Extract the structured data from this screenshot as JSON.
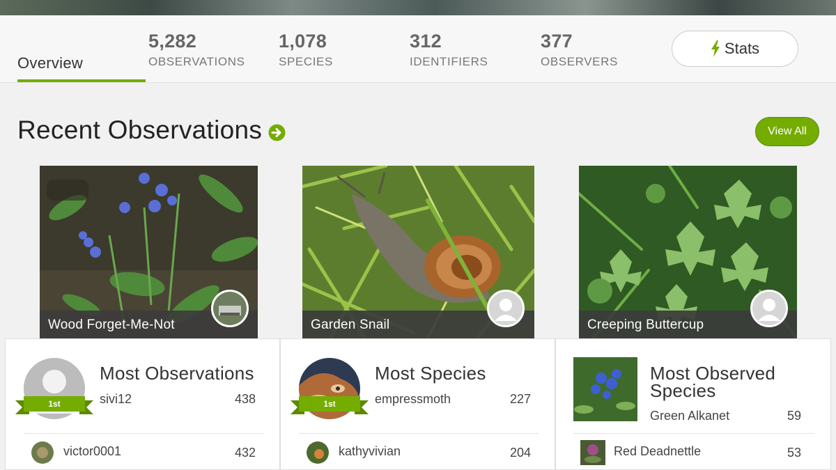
{
  "tabs": {
    "overview": "Overview"
  },
  "stats": [
    {
      "value": "5,282",
      "label": "OBSERVATIONS"
    },
    {
      "value": "1,078",
      "label": "SPECIES"
    },
    {
      "value": "312",
      "label": "IDENTIFIERS"
    },
    {
      "value": "377",
      "label": "OBSERVERS"
    }
  ],
  "stats_button": {
    "label": "Stats",
    "icon": "bolt-icon"
  },
  "recent": {
    "title": "Recent Observations",
    "view_all": "View All",
    "observations": [
      {
        "name": "Wood Forget-Me-Not",
        "avatar": "user-photo"
      },
      {
        "name": "Garden Snail",
        "avatar": "default-user-icon"
      },
      {
        "name": "Creeping Buttercup",
        "avatar": "default-user-icon"
      }
    ]
  },
  "leaders": {
    "most_observations": {
      "title": "Most Observations",
      "rank": "1st",
      "first": {
        "name": "sivi12",
        "count": "438"
      },
      "second": {
        "name": "victor0001",
        "count": "432"
      }
    },
    "most_species": {
      "title": "Most Species",
      "rank": "1st",
      "first": {
        "name": "empressmoth",
        "count": "227"
      },
      "second": {
        "name": "kathyvivian",
        "count": "204"
      }
    },
    "most_observed_species": {
      "title": "Most Observed Species",
      "first": {
        "name": "Green Alkanet",
        "count": "59"
      },
      "second": {
        "name": "Red Deadnettle",
        "count": "53"
      }
    }
  },
  "colors": {
    "accent": "#74ac00",
    "caption_bg": "#3c3c3c"
  }
}
